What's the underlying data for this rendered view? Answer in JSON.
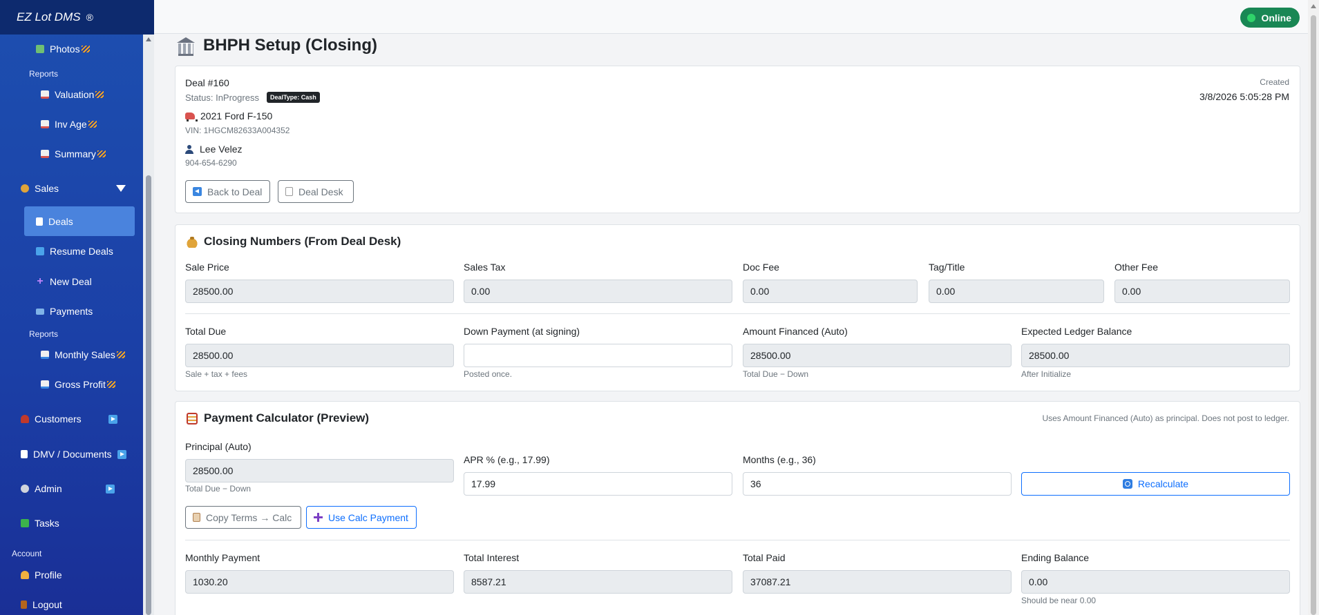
{
  "app": {
    "brand": "EZ Lot DMS",
    "brand_mark": "®",
    "status": "Online"
  },
  "sidebar": {
    "items": [
      {
        "label": "Photos"
      },
      {
        "label": "Reports"
      },
      {
        "label": "Valuation"
      },
      {
        "label": "Inv Age"
      },
      {
        "label": "Summary"
      },
      {
        "label": "Sales"
      },
      {
        "label": "Deals"
      },
      {
        "label": "Resume Deals"
      },
      {
        "label": "New Deal"
      },
      {
        "label": "Payments"
      },
      {
        "label": "Reports"
      },
      {
        "label": "Monthly Sales"
      },
      {
        "label": "Gross Profit"
      },
      {
        "label": "Customers"
      },
      {
        "label": "DMV / Documents"
      },
      {
        "label": "Admin"
      },
      {
        "label": "Tasks"
      },
      {
        "label": "Account"
      },
      {
        "label": "Profile"
      },
      {
        "label": "Logout"
      }
    ],
    "active": "Deals"
  },
  "page": {
    "title": "BHPH Setup (Closing)"
  },
  "deal": {
    "number": "Deal #160",
    "status": "Status: InProgress",
    "type_badge": "DealType: Cash",
    "vehicle": "2021 Ford F-150",
    "vin": "VIN: 1HGCM82633A004352",
    "customer": "Lee Velez",
    "phone": "904-654-6290",
    "created_label": "Created",
    "created_value": "3/8/2026 5:05:28 PM",
    "back_button": "Back to Deal",
    "desk_button": "Deal Desk"
  },
  "closing": {
    "title": "Closing Numbers (From Deal Desk)",
    "sale_price": {
      "label": "Sale Price",
      "value": "28500.00"
    },
    "sales_tax": {
      "label": "Sales Tax",
      "value": "0.00"
    },
    "doc_fee": {
      "label": "Doc Fee",
      "value": "0.00"
    },
    "tag_title": {
      "label": "Tag/Title",
      "value": "0.00"
    },
    "other_fee": {
      "label": "Other Fee",
      "value": "0.00"
    },
    "total_due": {
      "label": "Total Due",
      "value": "28500.00",
      "hint": "Sale + tax + fees"
    },
    "down_payment": {
      "label": "Down Payment (at signing)",
      "value": "",
      "hint": "Posted once."
    },
    "amount_financed": {
      "label": "Amount Financed (Auto)",
      "value": "28500.00",
      "hint": "Total Due − Down"
    },
    "expected_balance": {
      "label": "Expected Ledger Balance",
      "value": "28500.00",
      "hint": "After Initialize"
    }
  },
  "calculator": {
    "title": "Payment Calculator (Preview)",
    "note": "Uses Amount Financed (Auto) as principal. Does not post to ledger.",
    "principal": {
      "label": "Principal (Auto)",
      "value": "28500.00",
      "hint": "Total Due − Down"
    },
    "apr": {
      "label": "APR % (e.g., 17.99)",
      "value": "17.99"
    },
    "months": {
      "label": "Months (e.g., 36)",
      "value": "36"
    },
    "recalc_button": "Recalculate",
    "copy_button": "Copy Terms → Calc",
    "use_button": "Use Calc Payment",
    "monthly_payment": {
      "label": "Monthly Payment",
      "value": "1030.20"
    },
    "total_interest": {
      "label": "Total Interest",
      "value": "8587.21"
    },
    "total_paid": {
      "label": "Total Paid",
      "value": "37087.21"
    },
    "ending_balance": {
      "label": "Ending Balance",
      "value": "0.00",
      "hint": "Should be near 0.00"
    }
  }
}
